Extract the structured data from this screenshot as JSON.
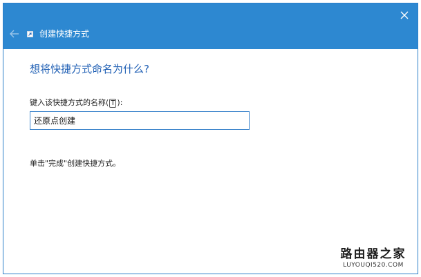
{
  "window": {
    "title": "创建快捷方式",
    "accent_color": "#2d88d1"
  },
  "icons": {
    "close": "close-icon",
    "back": "back-arrow-icon",
    "shortcut": "shortcut-icon"
  },
  "main": {
    "heading": "想将快捷方式命名为什么?",
    "label_prefix": "键入该快捷方式的名称(",
    "label_access_key": "T",
    "label_suffix": "):",
    "name_value": "还原点创建",
    "hint": "单击\"完成\"创建快捷方式。"
  },
  "watermark": {
    "line1": "路由器之家",
    "line2": "LUYOUQI520.COM"
  }
}
